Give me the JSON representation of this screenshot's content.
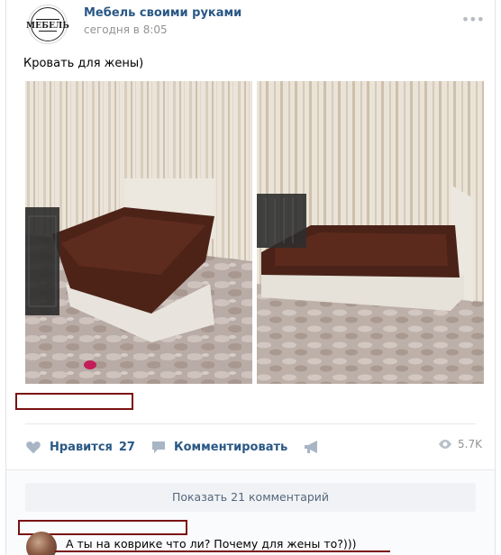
{
  "post": {
    "author": "Мебель своими руками",
    "time": "сегодня в 8:05",
    "text": "Кровать для жены)",
    "avatar_logo_text": "МЕБЕЛЬ"
  },
  "actions": {
    "like_label": "Нравится",
    "like_count": "27",
    "comment_label": "Комментировать",
    "views": "5.7K"
  },
  "comments": {
    "show_all_label": "Показать 21 комментарий",
    "first_comment_text": "А ты на коврике что ли? Почему для жены то?)))"
  },
  "icons": {
    "more": "more-dots-icon",
    "like": "heart-icon",
    "comment": "comment-bubble-icon",
    "share": "megaphone-icon",
    "views": "eye-icon"
  },
  "colors": {
    "link": "#2a5885",
    "muted": "#939393",
    "icon": "#a8b5c4",
    "redaction": "#7a1212"
  }
}
